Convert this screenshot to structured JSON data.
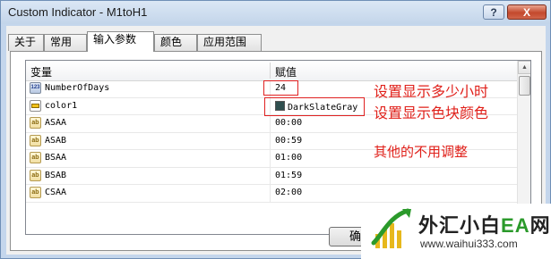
{
  "window": {
    "title": "Custom Indicator - M1toH1",
    "help_label": "?",
    "close_label": "X"
  },
  "tabs": [
    {
      "label": "关于"
    },
    {
      "label": "常用"
    },
    {
      "label": "输入参数"
    },
    {
      "label": "颜色"
    },
    {
      "label": "应用范围"
    }
  ],
  "grid": {
    "col_variable": "变量",
    "col_value": "赋值",
    "rows": [
      {
        "icon": "number-icon",
        "icon_text": "123",
        "name": "NumberOfDays",
        "value": "24"
      },
      {
        "icon": "color-icon",
        "icon_text": "",
        "name": "color1",
        "value": "DarkSlateGray"
      },
      {
        "icon": "string-icon",
        "icon_text": "ab",
        "name": "ASAA",
        "value": "00:00"
      },
      {
        "icon": "string-icon",
        "icon_text": "ab",
        "name": "ASAB",
        "value": "00:59"
      },
      {
        "icon": "string-icon",
        "icon_text": "ab",
        "name": "BSAA",
        "value": "01:00"
      },
      {
        "icon": "string-icon",
        "icon_text": "ab",
        "name": "BSAB",
        "value": "01:59"
      },
      {
        "icon": "string-icon",
        "icon_text": "ab",
        "name": "CSAA",
        "value": "02:00"
      }
    ],
    "color_swatch": "#2f4f4f"
  },
  "annotations": {
    "note_days": "设置显示多少小时",
    "note_color": "设置显示色块颜色",
    "note_other": "其他的不用调整",
    "color": "#e0201a"
  },
  "buttons": {
    "ok_label": "确"
  },
  "watermark": {
    "brand_prefix": "外汇小白",
    "brand_ea": "EA",
    "brand_suffix": "网",
    "url": "www.waihui333.com"
  }
}
